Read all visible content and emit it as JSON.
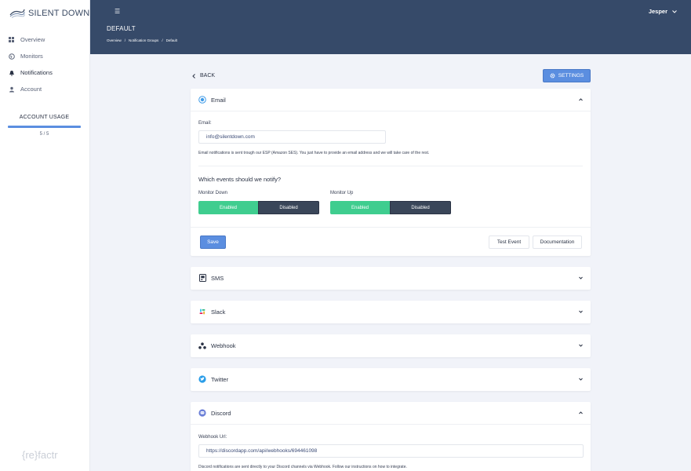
{
  "brand": {
    "name": "SILENT DOWN"
  },
  "sidebar": {
    "items": [
      {
        "label": "Overview",
        "icon": "grid-icon"
      },
      {
        "label": "Monitors",
        "icon": "globe-icon"
      },
      {
        "label": "Notifications",
        "icon": "bell-icon"
      },
      {
        "label": "Account",
        "icon": "user-icon"
      }
    ]
  },
  "usage": {
    "title": "ACCOUNT USAGE",
    "count": "5 / 5",
    "fraction": 1.0
  },
  "footer_brand": "{re}factr",
  "header": {
    "user": "Jesper",
    "title": "DEFAULT",
    "breadcrumb": [
      "Overview",
      "/",
      "Notification Groups",
      "/",
      "Default"
    ]
  },
  "toolbar": {
    "back": "BACK",
    "settings": "SETTINGS"
  },
  "email": {
    "title": "Email",
    "field_label": "Email:",
    "value": "info@silentdown.com",
    "help": "Email notifications is sent trough our ESP (Amazon SES). You just have to provide an email address and we will take care of the rest.",
    "events_title": "Which events should we notify?",
    "monitor_down": "Monitor Down",
    "monitor_up": "Monitor Up",
    "enabled": "Enabled",
    "disabled": "Disabled",
    "save": "Save",
    "test": "Test Event",
    "docs": "Documentation"
  },
  "channels": [
    {
      "title": "SMS",
      "icon": "sms-icon"
    },
    {
      "title": "Slack",
      "icon": "slack-icon"
    },
    {
      "title": "Webhook",
      "icon": "webhook-icon"
    },
    {
      "title": "Twitter",
      "icon": "twitter-icon"
    }
  ],
  "discord": {
    "title": "Discord",
    "field_label": "Webhook Url:",
    "value": "https://discordapp.com/api/webhooks/694461098",
    "help": "Discord notifications are sent directly to your Discord channels via Webhook. Follow our instructions on how to integrate."
  },
  "colors": {
    "topbar": "#364a69",
    "accent": "#5b8ee0",
    "enabled": "#3fcd8f",
    "disabled": "#3a4659"
  }
}
